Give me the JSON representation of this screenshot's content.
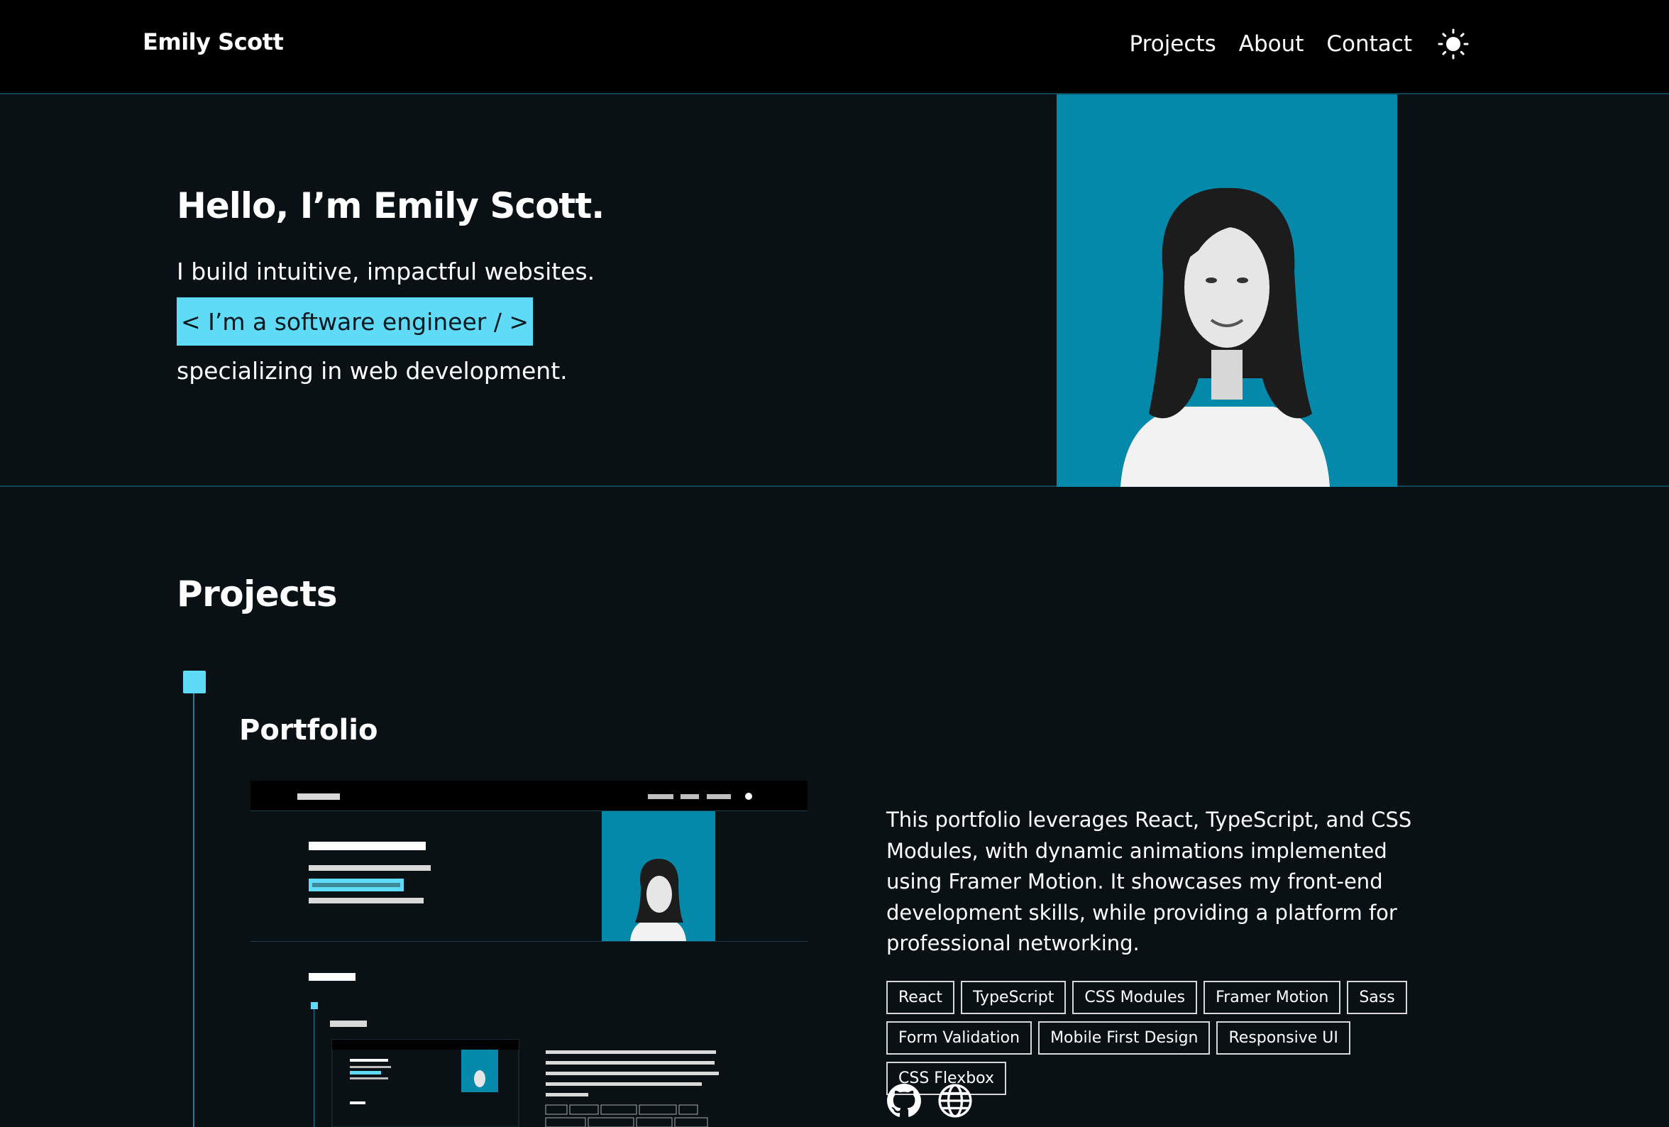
{
  "header": {
    "brand": "Emily Scott",
    "nav": [
      "Projects",
      "About",
      "Contact"
    ],
    "theme_icon": "sun-icon"
  },
  "hero": {
    "title": "Hello, I’m Emily Scott.",
    "line1": "I build intuitive, impactful websites.",
    "highlight": "< I’m a software engineer / >",
    "line3": "specializing in web development."
  },
  "projects": {
    "title": "Projects",
    "items": [
      {
        "name": "Portfolio",
        "description": "This portfolio leverages React, TypeScript, and CSS Modules, with dynamic animations implemented using Framer Motion. It showcases my front-end development skills, while providing a platform for professional networking.",
        "tags": [
          "React",
          "TypeScript",
          "CSS Modules",
          "Framer Motion",
          "Sass",
          "Form Validation",
          "Mobile First Design",
          "Responsive UI",
          "CSS Flexbox"
        ],
        "links": [
          "github-icon",
          "globe-icon"
        ]
      }
    ]
  },
  "colors": {
    "accent": "#5fdbf8",
    "photo_bg": "#0589ab",
    "background": "#0a1115",
    "header_bg": "#000000"
  }
}
